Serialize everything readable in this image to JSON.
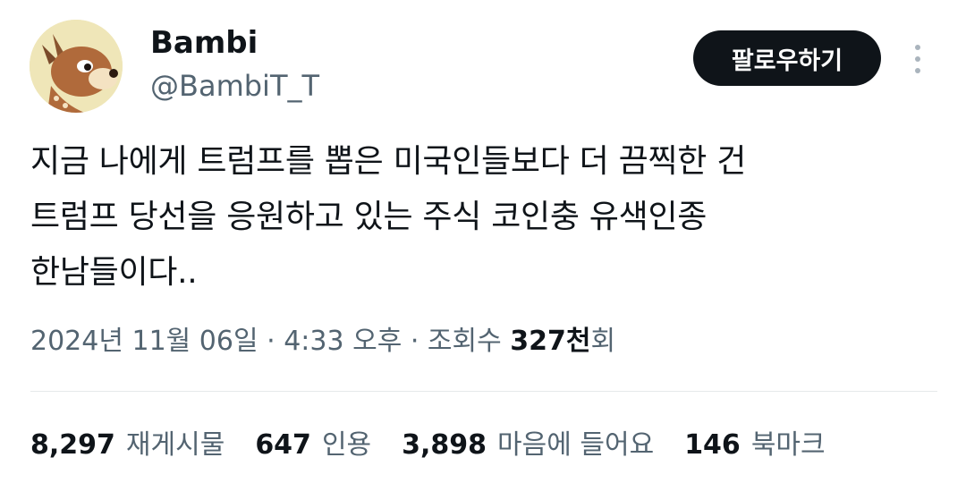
{
  "user": {
    "display_name": "Bambi",
    "handle": "@BambiT_T",
    "avatar_icon": "bambi-fawn-avatar"
  },
  "follow_label": "팔로우하기",
  "more_icon": "more-vertical-icon",
  "tweet": {
    "text": "지금 나에게 트럼프를 뽑은 미국인들보다 더 끔찍한 건\n트럼프 당선을 응원하고 있는 주식 코인충 유색인종\n한남들이다.."
  },
  "meta": {
    "date": "2024년 11월 06일",
    "separator": " · ",
    "time": "4:33 오후",
    "views_label": "조회수 ",
    "views_count": "327천",
    "views_suffix": "회"
  },
  "stats": [
    {
      "count": "8,297",
      "label": "재게시물"
    },
    {
      "count": "647",
      "label": "인용"
    },
    {
      "count": "3,898",
      "label": "마음에 들어요"
    },
    {
      "count": "146",
      "label": "북마크"
    }
  ],
  "colors": {
    "text_primary": "#0f1419",
    "text_secondary": "#536471",
    "button_bg": "#0f1419",
    "divider": "#e6e9eb"
  }
}
